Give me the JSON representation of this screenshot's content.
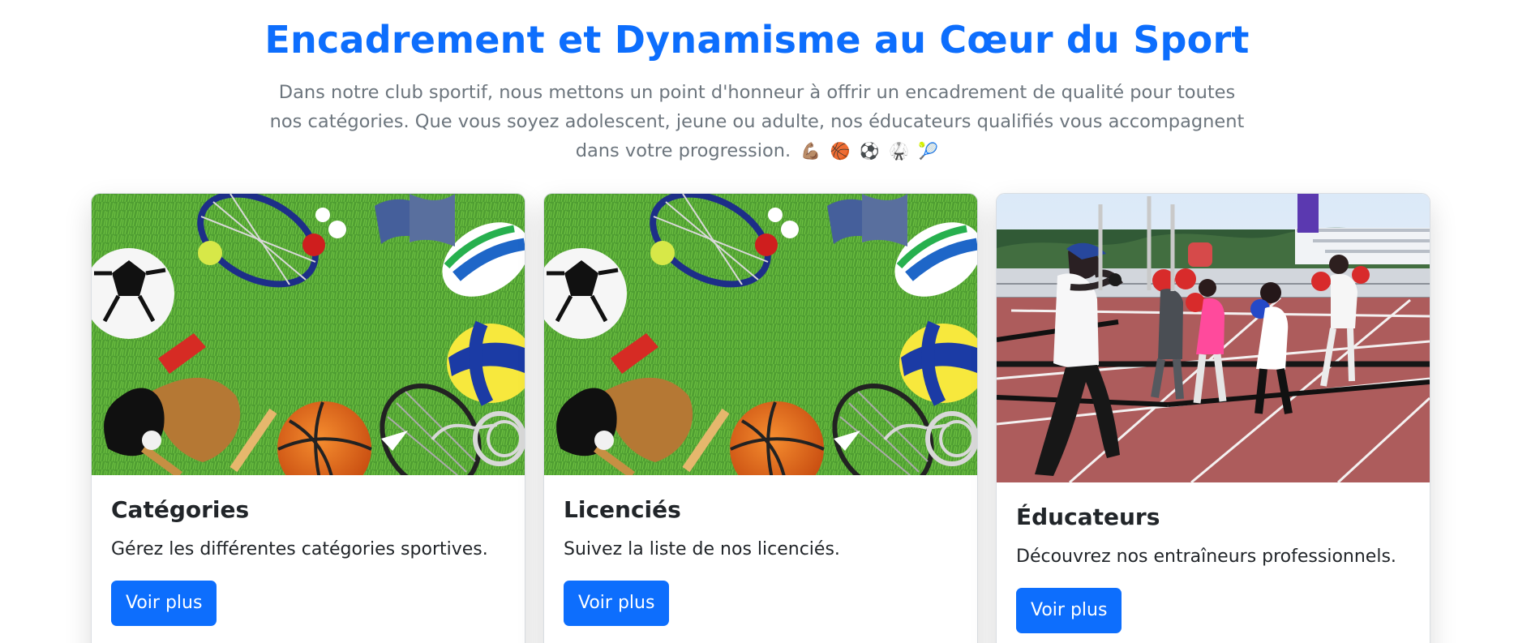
{
  "hero": {
    "title": "Encadrement et Dynamisme au Cœur du Sport",
    "text": "Dans notre club sportif, nous mettons un point d'honneur à offrir un encadrement de qualité pour toutes nos catégories. Que vous soyez adolescent, jeune ou adulte, nos éducateurs qualifiés vous accompagnent dans votre progression.",
    "emojis": [
      "💪🏽",
      "🏀",
      "⚽",
      "🥋",
      "🎾"
    ]
  },
  "cards": [
    {
      "image_icon": "sports-equipment-image-icon",
      "title": "Catégories",
      "text": "Gérez les différentes catégories sportives.",
      "button_label": "Voir plus"
    },
    {
      "image_icon": "sports-equipment-image-icon",
      "title": "Licenciés",
      "text": "Suivez la liste de nos licenciés.",
      "button_label": "Voir plus"
    },
    {
      "image_icon": "boxing-training-image-icon",
      "title": "Éducateurs",
      "text": "Découvrez nos entraîneurs professionnels.",
      "button_label": "Voir plus"
    }
  ],
  "colors": {
    "primary": "#0d6efd",
    "text": "#212529",
    "muted": "#6c757d",
    "grass": "#4f9e32",
    "track": "#b55d5c"
  }
}
